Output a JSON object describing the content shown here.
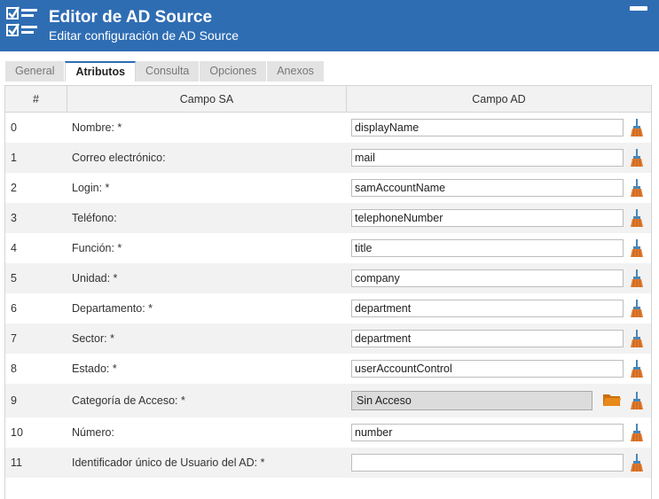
{
  "header": {
    "title": "Editor de AD Source",
    "subtitle": "Editar configuración de AD Source"
  },
  "tabs": [
    {
      "label": "General",
      "active": false
    },
    {
      "label": "Atributos",
      "active": true
    },
    {
      "label": "Consulta",
      "active": false
    },
    {
      "label": "Opciones",
      "active": false
    },
    {
      "label": "Anexos",
      "active": false
    }
  ],
  "grid": {
    "columns": [
      "#",
      "Campo SA",
      "Campo AD"
    ],
    "rows": [
      {
        "num": "0",
        "sa": "Nombre: *",
        "ad": "displayName"
      },
      {
        "num": "1",
        "sa": "Correo electrónico:",
        "ad": "mail"
      },
      {
        "num": "2",
        "sa": "Login: *",
        "ad": "samAccountName"
      },
      {
        "num": "3",
        "sa": "Teléfono:",
        "ad": "telephoneNumber"
      },
      {
        "num": "4",
        "sa": "Función: *",
        "ad": "title"
      },
      {
        "num": "5",
        "sa": "Unidad: *",
        "ad": "company"
      },
      {
        "num": "6",
        "sa": "Departamento: *",
        "ad": "department"
      },
      {
        "num": "7",
        "sa": "Sector: *",
        "ad": "department"
      },
      {
        "num": "8",
        "sa": "Estado: *",
        "ad": "userAccountControl"
      },
      {
        "num": "9",
        "sa": "Categoría de Acceso: *",
        "ad": "Sin Acceso"
      },
      {
        "num": "10",
        "sa": "Número:",
        "ad": "number"
      },
      {
        "num": "11",
        "sa": "Identificador único de Usuario del AD: *",
        "ad": ""
      }
    ]
  },
  "icons": {
    "logo": "checklist-icon",
    "minimize": "minimize-icon",
    "clear": "broom-icon",
    "browse": "folder-icon"
  },
  "colors": {
    "header": "#2f6db3",
    "broom_handle": "#4a86b5",
    "broom_bristles": "#e07a2e",
    "folder": "#e8891a"
  }
}
